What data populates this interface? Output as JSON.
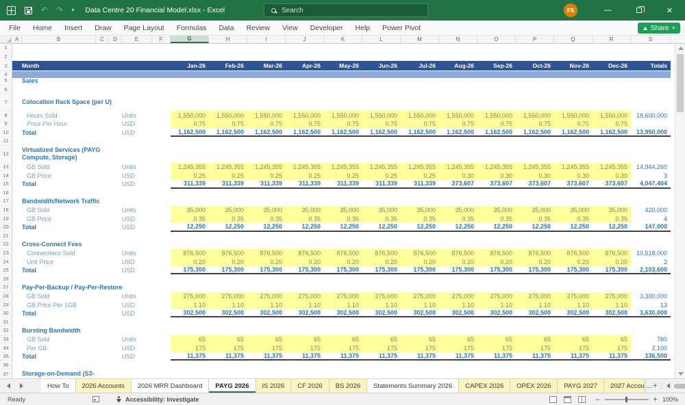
{
  "title_bar": {
    "title": "Data Centre 20 Financial Model.xlsx  -  Excel",
    "search_placeholder": "Search",
    "avatar_initials": "FS"
  },
  "ribbon": {
    "tabs": [
      "File",
      "Home",
      "Insert",
      "Draw",
      "Page Layout",
      "Formulas",
      "Data",
      "Review",
      "View",
      "Developer",
      "Help",
      "Power Pivot"
    ],
    "share_label": "Share"
  },
  "column_headers": {
    "letters": [
      "A",
      "B",
      "C",
      "D",
      "E",
      "F",
      "G",
      "H",
      "I",
      "J",
      "K",
      "L",
      "M",
      "N",
      "O",
      "P",
      "Q",
      "R",
      "S"
    ],
    "widths": [
      14,
      108,
      19,
      19,
      44,
      27,
      56,
      56,
      56,
      56,
      56,
      56,
      56,
      56,
      56,
      56,
      56,
      56,
      58
    ],
    "selected": "G"
  },
  "sheet": {
    "month_label": "Month",
    "months": [
      "Jan-26",
      "Feb-26",
      "Mar-26",
      "Apr-26",
      "May-26",
      "Jun-26",
      "Jul-26",
      "Aug-26",
      "Sep-26",
      "Oct-26",
      "Nov-26",
      "Dec-26"
    ],
    "totals_label": "Totals",
    "rows": [
      {
        "n": 1,
        "type": "blank"
      },
      {
        "n": 2,
        "type": "blank"
      },
      {
        "n": 3,
        "type": "month_header"
      },
      {
        "n": 4,
        "type": "band"
      },
      {
        "n": 5,
        "type": "section",
        "label": "Sales"
      },
      {
        "n": 6,
        "type": "blank"
      },
      {
        "n": 7,
        "type": "section_tall",
        "label": "Colocation Rack Space (per U)"
      },
      {
        "n": 8,
        "type": "data",
        "label": "Hours Sold",
        "unit": "Units",
        "values": [
          "1,550,000",
          "1,550,000",
          "1,550,000",
          "1,550,000",
          "1,550,000",
          "1,550,000",
          "1,550,000",
          "1,550,000",
          "1,550,000",
          "1,550,000",
          "1,550,000",
          "1,550,000"
        ],
        "total": "18,600,000"
      },
      {
        "n": 9,
        "type": "data",
        "label": "Price Per Hour",
        "unit": "USD",
        "values": [
          "0.75",
          "0.75",
          "0.75",
          "0.75",
          "0.75",
          "0.75",
          "0.75",
          "0.75",
          "0.75",
          "0.75",
          "0.75",
          "0.75"
        ],
        "total": ""
      },
      {
        "n": 10,
        "type": "total",
        "label": "Total",
        "unit": "USD",
        "values": [
          "1,162,500",
          "1,162,500",
          "1,162,500",
          "1,162,500",
          "1,162,500",
          "1,162,500",
          "1,162,500",
          "1,162,500",
          "1,162,500",
          "1,162,500",
          "1,162,500",
          "1,162,500"
        ],
        "total": "13,950,000"
      },
      {
        "n": 11,
        "type": "blank"
      },
      {
        "n": 12,
        "type": "section_tall",
        "label": "Virtualized Services (PAYG Compute, Storage)"
      },
      {
        "n": 13,
        "type": "data",
        "label": "GB Sold",
        "unit": "Units",
        "values": [
          "1,245,355",
          "1,245,355",
          "1,245,355",
          "1,245,355",
          "1,245,355",
          "1,245,355",
          "1,245,355",
          "1,245,355",
          "1,245,355",
          "1,245,355",
          "1,245,355",
          "1,245,355"
        ],
        "total": "14,944,260"
      },
      {
        "n": 14,
        "type": "data",
        "label": "GB Price",
        "unit": "USD",
        "values": [
          "0.25",
          "0.25",
          "0.25",
          "0.25",
          "0.25",
          "0.25",
          "0.25",
          "0.30",
          "0.30",
          "0.30",
          "0.30",
          "0.30"
        ],
        "total": "3"
      },
      {
        "n": 15,
        "type": "total",
        "label": "Total",
        "unit": "USD",
        "values": [
          "311,339",
          "311,339",
          "311,339",
          "311,339",
          "311,339",
          "311,339",
          "311,339",
          "373,607",
          "373,607",
          "373,607",
          "373,607",
          "373,607"
        ],
        "total": "4,047,404"
      },
      {
        "n": 16,
        "type": "blank"
      },
      {
        "n": 17,
        "type": "section",
        "label": "Bandwidth/Network Traffic"
      },
      {
        "n": 18,
        "type": "data",
        "label": "GB Sold",
        "unit": "Units",
        "values": [
          "35,000",
          "35,000",
          "35,000",
          "35,000",
          "35,000",
          "35,000",
          "35,000",
          "35,000",
          "35,000",
          "35,000",
          "35,000",
          "35,000"
        ],
        "total": "420,000"
      },
      {
        "n": 19,
        "type": "data",
        "label": "GB Price",
        "unit": "USD",
        "values": [
          "0.35",
          "0.35",
          "0.35",
          "0.35",
          "0.35",
          "0.35",
          "0.35",
          "0.35",
          "0.35",
          "0.35",
          "0.35",
          "0.35"
        ],
        "total": "4"
      },
      {
        "n": 20,
        "type": "total",
        "label": "Total",
        "unit": "USD",
        "values": [
          "12,250",
          "12,250",
          "12,250",
          "12,250",
          "12,250",
          "12,250",
          "12,250",
          "12,250",
          "12,250",
          "12,250",
          "12,250",
          "12,250"
        ],
        "total": "147,000"
      },
      {
        "n": 21,
        "type": "blank"
      },
      {
        "n": 22,
        "type": "section",
        "label": "Cross-Connect Fees"
      },
      {
        "n": 23,
        "type": "data",
        "label": "Connections Sold",
        "unit": "Units",
        "values": [
          "876,500",
          "876,500",
          "876,500",
          "876,500",
          "876,500",
          "876,500",
          "876,500",
          "876,500",
          "876,500",
          "876,500",
          "876,500",
          "876,500"
        ],
        "total": "10,518,000"
      },
      {
        "n": 24,
        "type": "data",
        "label": "Unit Price",
        "unit": "USD",
        "values": [
          "0.20",
          "0.20",
          "0.20",
          "0.20",
          "0.20",
          "0.20",
          "0.20",
          "0.20",
          "0.20",
          "0.20",
          "0.20",
          "0.20"
        ],
        "total": "2"
      },
      {
        "n": 25,
        "type": "total",
        "label": "Total",
        "unit": "USD",
        "values": [
          "175,300",
          "175,300",
          "175,300",
          "175,300",
          "175,300",
          "175,300",
          "175,300",
          "175,300",
          "175,300",
          "175,300",
          "175,300",
          "175,300"
        ],
        "total": "2,103,600"
      },
      {
        "n": 26,
        "type": "blank"
      },
      {
        "n": 27,
        "type": "section",
        "label": "Pay-Per-Backup / Pay-Per-Restore"
      },
      {
        "n": 28,
        "type": "data",
        "label": "GB Sold",
        "unit": "Units",
        "values": [
          "275,000",
          "275,000",
          "275,000",
          "275,000",
          "275,000",
          "275,000",
          "275,000",
          "275,000",
          "275,000",
          "275,000",
          "275,000",
          "275,000"
        ],
        "total": "3,300,000"
      },
      {
        "n": 29,
        "type": "data",
        "label": "GB Price Per 1GB",
        "unit": "USD",
        "values": [
          "1.10",
          "1.10",
          "1.10",
          "1.10",
          "1.10",
          "1.10",
          "1.10",
          "1.10",
          "1.10",
          "1.10",
          "1.10",
          "1.10"
        ],
        "total": "13"
      },
      {
        "n": 30,
        "type": "total",
        "label": "Total",
        "unit": "USD",
        "values": [
          "302,500",
          "302,500",
          "302,500",
          "302,500",
          "302,500",
          "302,500",
          "302,500",
          "302,500",
          "302,500",
          "302,500",
          "302,500",
          "302,500"
        ],
        "total": "3,630,000"
      },
      {
        "n": 31,
        "type": "blank"
      },
      {
        "n": 32,
        "type": "section",
        "label": "Bursting Bandwidth"
      },
      {
        "n": 33,
        "type": "data",
        "label": "GB Sold",
        "unit": "Units",
        "values": [
          "65",
          "65",
          "65",
          "65",
          "65",
          "65",
          "65",
          "65",
          "65",
          "65",
          "65",
          "65"
        ],
        "total": "780"
      },
      {
        "n": 34,
        "type": "data",
        "label": "Per GB",
        "unit": "USD",
        "values": [
          "175",
          "175",
          "175",
          "175",
          "175",
          "175",
          "175",
          "175",
          "175",
          "175",
          "175",
          "175"
        ],
        "total": "2,100"
      },
      {
        "n": 35,
        "type": "total",
        "label": "Total",
        "unit": "USD",
        "values": [
          "11,375",
          "11,375",
          "11,375",
          "11,375",
          "11,375",
          "11,375",
          "11,375",
          "11,375",
          "11,375",
          "11,375",
          "11,375",
          "11,375"
        ],
        "total": "136,500"
      },
      {
        "n": 36,
        "type": "blank"
      },
      {
        "n": 37,
        "type": "section_tall",
        "label": "Storage-on-Demand (S3-"
      }
    ]
  },
  "sheet_tabs": {
    "tabs": [
      {
        "label": "How To",
        "color": "white"
      },
      {
        "label": "2026 Accounts",
        "color": "yellow"
      },
      {
        "label": "2026 MRR Dashboard",
        "color": "white"
      },
      {
        "label": "PAYG 2026",
        "color": "white",
        "active": true
      },
      {
        "label": "IS 2026",
        "color": "yellow"
      },
      {
        "label": "CF 2026",
        "color": "yellow"
      },
      {
        "label": "BS 2026",
        "color": "yellow"
      },
      {
        "label": "Statements Summary 2026",
        "color": "white"
      },
      {
        "label": "CAPEX 2026",
        "color": "yellow"
      },
      {
        "label": "OPEX 2026",
        "color": "yellow"
      },
      {
        "label": "PAYG 2027",
        "color": "yellow"
      },
      {
        "label": "2027 Accou",
        "color": "yellow",
        "truncated": true
      }
    ],
    "overflow_label": "…",
    "add_label": "+"
  },
  "status_bar": {
    "ready": "Ready",
    "accessibility": "Accessibility: Investigate",
    "zoom": "100%"
  },
  "colors": {
    "title_green": "#217346",
    "header_blue": "#2F5496",
    "band_blue": "#8EAADB",
    "accent_blue": "#2E75B6",
    "input_yellow": "#FFFF9C",
    "tab_yellow": "#FBF3C0",
    "avatar_orange": "#D8820A"
  }
}
